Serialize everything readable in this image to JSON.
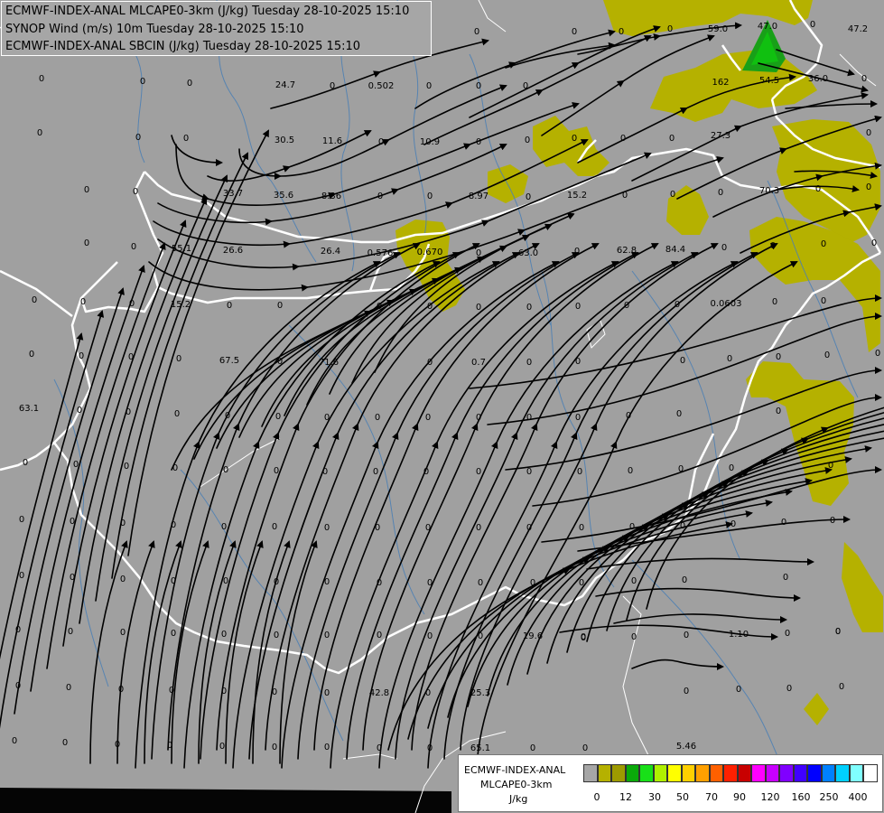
{
  "titles": {
    "line1": "ECMWF-INDEX-ANAL MLCAPE0-3km (J/kg) Tuesday 28-10-2025 15:10",
    "line2": "SYNOP Wind (m/s) 10m Tuesday 28-10-2025 15:10",
    "line3": "ECMWF-INDEX-ANAL SBCIN (J/kg) Tuesday 28-10-2025 15:10"
  },
  "legend": {
    "title1": "ECMWF-INDEX-ANAL",
    "title2": "MLCAPE0-3km",
    "unit": "J/kg",
    "colors": [
      "#a6a6a6",
      "#b5b100",
      "#9e9a00",
      "#0aaa0a",
      "#18e018",
      "#b0f000",
      "#ffff00",
      "#ffd000",
      "#ffa000",
      "#ff6000",
      "#ff2000",
      "#c80000",
      "#ff00ff",
      "#c800ff",
      "#8000ff",
      "#4000ff",
      "#0000ff",
      "#0080ff",
      "#00d0ff",
      "#80ffff",
      "#ffffff"
    ],
    "ticks": [
      "0",
      "12",
      "30",
      "50",
      "70",
      "90",
      "120",
      "160",
      "250",
      "400"
    ]
  },
  "colors": {
    "background": "#a0a0a0",
    "cape_low": "#b5b100",
    "cape_mid": "#18a018",
    "borders": "#ffffff",
    "rivers": "#4a7fb5",
    "streamlines": "#000000"
  },
  "station_values": [
    "0",
    "0",
    "0",
    "0",
    "0",
    "0",
    "59.0",
    "47.0",
    "47.2",
    "0",
    "0",
    "0",
    "0",
    "24.7",
    "0",
    "0.502",
    "0",
    "0",
    "0",
    "162",
    "54.5",
    "36.0",
    "0",
    "0",
    "0",
    "0",
    "30.5",
    "11.6",
    "0",
    "10.9",
    "0",
    "0",
    "0",
    "0",
    "0",
    "27.3",
    "0",
    "0",
    "0",
    "33.7",
    "35.6",
    "8.36",
    "0",
    "0",
    "8.97",
    "0",
    "15.2",
    "0",
    "0",
    "0",
    "70.3",
    "0",
    "0",
    "0",
    "0",
    "55.1",
    "26.6",
    "26.4",
    "0.576",
    "0.670",
    "0",
    "63.0",
    "0",
    "62.8",
    "84.4",
    "0",
    "0",
    "0",
    "0",
    "0",
    "0",
    "0",
    "15.2",
    "0",
    "0",
    "0",
    "0",
    "0",
    "0",
    "0",
    "0",
    "0",
    "0.0603",
    "0",
    "0",
    "0",
    "0",
    "0",
    "0",
    "67.5",
    "0",
    "71.6",
    "0",
    "0.7",
    "0",
    "0",
    "0",
    "0",
    "0",
    "0",
    "0",
    "63.1",
    "0",
    "0",
    "0",
    "0",
    "0",
    "0",
    "0",
    "0",
    "0",
    "0",
    "0",
    "0",
    "0",
    "0",
    "0",
    "0",
    "0",
    "0",
    "0",
    "0",
    "0",
    "0",
    "0",
    "0",
    "0",
    "0",
    "0",
    "0",
    "0",
    "0",
    "0",
    "0",
    "0",
    "0",
    "0",
    "0",
    "0",
    "0",
    "0",
    "0",
    "0",
    "0",
    "0",
    "0",
    "0",
    "0",
    "0",
    "0",
    "0",
    "0",
    "0",
    "0",
    "0",
    "0",
    "0",
    "0",
    "0",
    "0",
    "0",
    "0",
    "0",
    "0",
    "0",
    "0",
    "0",
    "0",
    "0",
    "0",
    "0",
    "0",
    "0",
    "0",
    "19.6",
    "0",
    "0",
    "0",
    "0",
    "1.10",
    "0",
    "0",
    "0",
    "0",
    "0",
    "0",
    "0",
    "0",
    "0",
    "0",
    "42.8",
    "0",
    "25.3",
    "0",
    "0",
    "0",
    "0",
    "0",
    "0",
    "0",
    "0",
    "0",
    "0",
    "0",
    "0",
    "0",
    "65.1",
    "0",
    "0",
    "5.46"
  ]
}
